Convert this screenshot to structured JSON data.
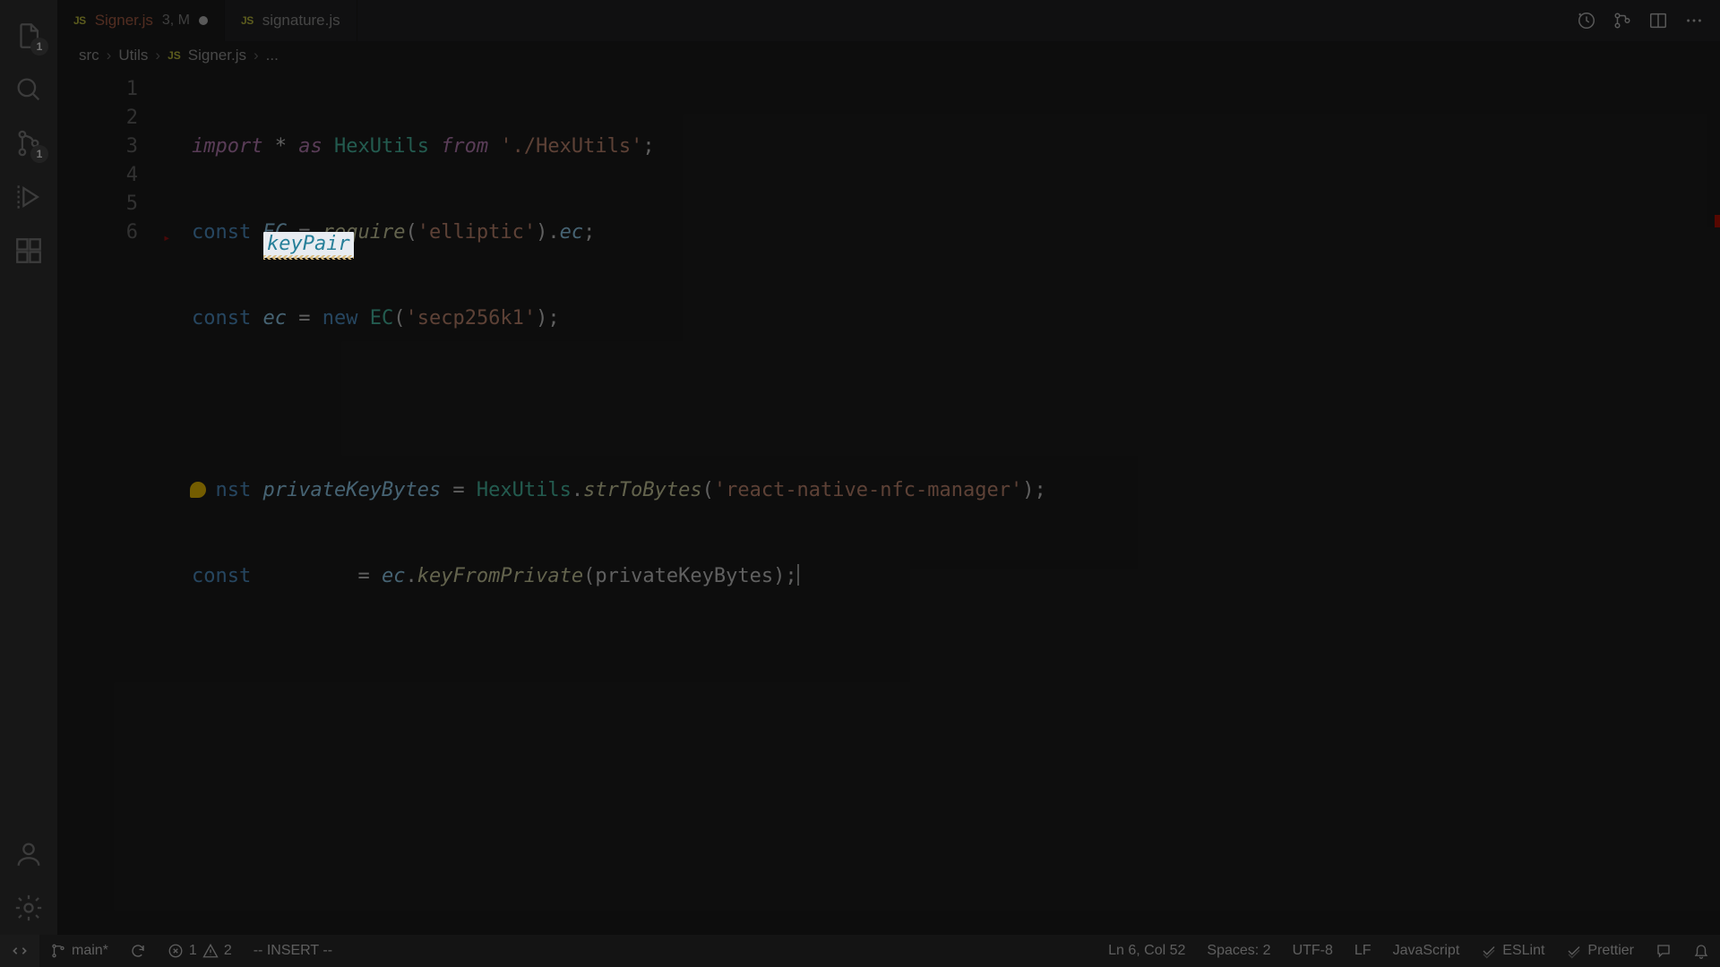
{
  "tabs": [
    {
      "icon": "JS",
      "name": "Signer.js",
      "annot": "3, M",
      "dirty": true,
      "active": true
    },
    {
      "icon": "JS",
      "name": "signature.js",
      "annot": "",
      "dirty": false,
      "active": false
    }
  ],
  "breadcrumbs": {
    "seg1": "src",
    "seg2": "Utils",
    "seg3": "Signer.js",
    "seg4": "..."
  },
  "activity_badges": {
    "explorer": "1",
    "scm": "1"
  },
  "code": {
    "lines": [
      "1",
      "2",
      "3",
      "4",
      "5",
      "6"
    ],
    "l1_import": "import",
    "l1_star": " * ",
    "l1_as": "as",
    "l1_hex": " HexUtils ",
    "l1_from": "from",
    "l1_path": " './HexUtils'",
    "l1_semi": ";",
    "l2_const": "const ",
    "l2_ec": "EC",
    "l2_eq": " = ",
    "l2_req": "require",
    "l2_open": "(",
    "l2_str": "'elliptic'",
    "l2_close": ")",
    "l2_dot": ".",
    "l2_prop": "ec",
    "l2_semi": ";",
    "l3_const": "const ",
    "l3_ec": "ec",
    "l3_eq": " = ",
    "l3_new": "new ",
    "l3_cls": "EC",
    "l3_open": "(",
    "l3_str": "'secp256k1'",
    "l3_close": ")",
    "l3_semi": ";",
    "l5_const": "  nst ",
    "l5_var": "privateKeyBytes",
    "l5_eq": " = ",
    "l5_obj": "HexUtils",
    "l5_dot": ".",
    "l5_fn": "strToBytes",
    "l5_open": "(",
    "l5_str": "'react-native-nfc-manager'",
    "l5_close": ")",
    "l5_semi": ";",
    "l6_const": "const ",
    "l6_gap": "        ",
    "l6_eq": "= ",
    "l6_obj": "ec",
    "l6_dot": ".",
    "l6_fn": "keyFromPrivate",
    "l6_open": "(",
    "l6_arg": "privateKeyBytes",
    "l6_close": ")",
    "l6_semi": ";"
  },
  "highlight_word": "keyPair",
  "status": {
    "branch": "main*",
    "errors": "1",
    "warnings": "2",
    "vim_mode": "-- INSERT --",
    "cursor": "Ln 6, Col 52",
    "spaces": "Spaces: 2",
    "encoding": "UTF-8",
    "eol": "LF",
    "language": "JavaScript",
    "eslint": "ESLint",
    "prettier": "Prettier"
  }
}
